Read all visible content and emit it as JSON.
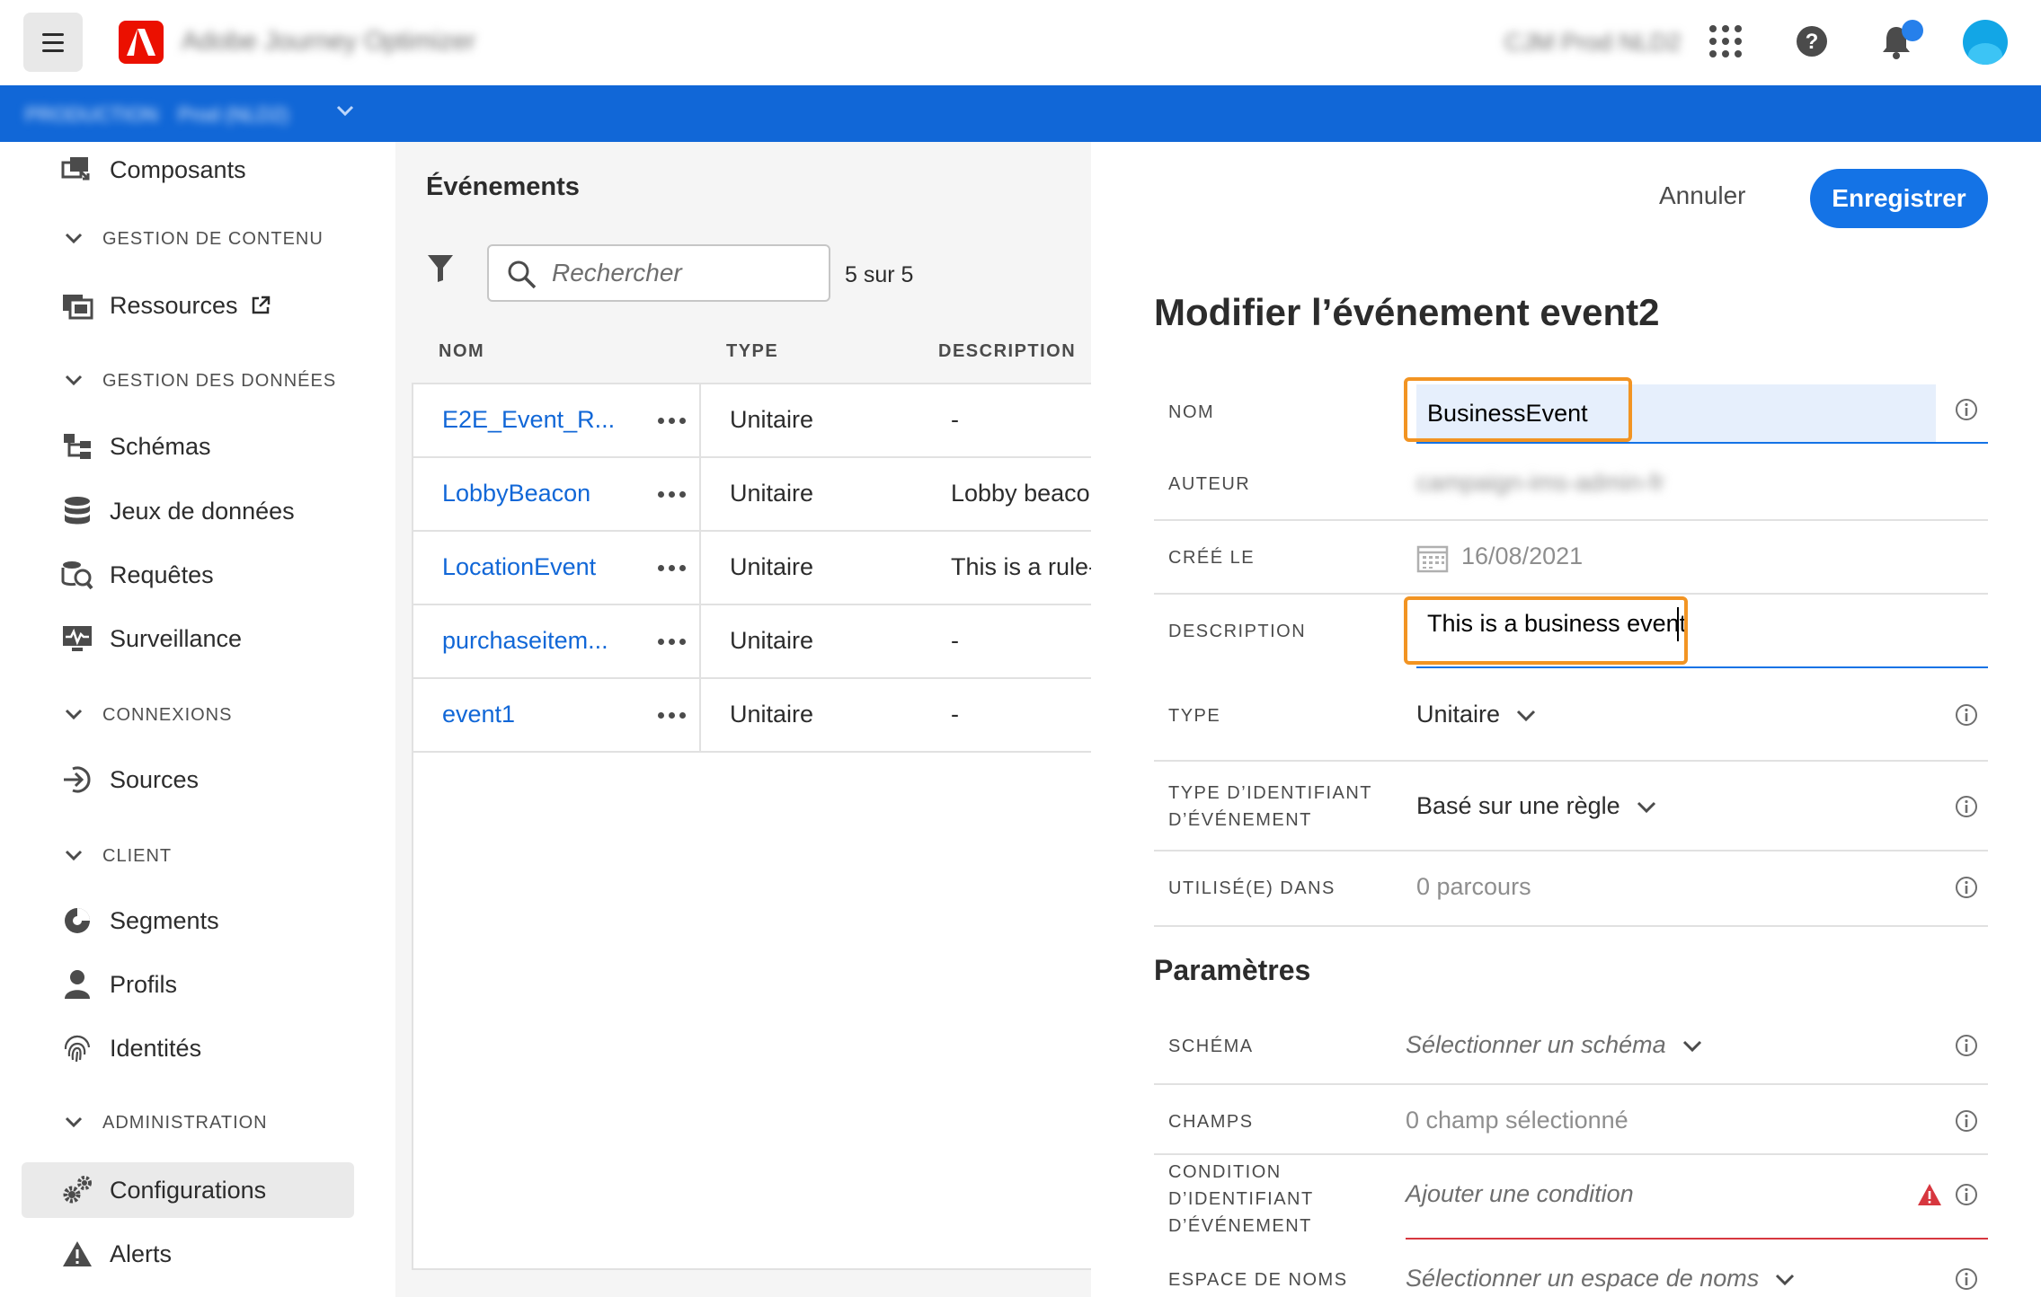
{
  "header": {
    "app_title": "Adobe Journey Optimizer",
    "org_name": "CJM Prod NLD2",
    "icons": [
      "menu-icon",
      "adobe-logo",
      "apps-grid-icon",
      "help-icon",
      "bell-icon",
      "avatar"
    ]
  },
  "sandbox": {
    "label": "PRODUCTION",
    "name": "Prod (NLD2)"
  },
  "sidebar": {
    "items": [
      {
        "label": "Composants",
        "icon": "components-icon"
      },
      {
        "section": "GESTION DE CONTENU"
      },
      {
        "label": "Ressources",
        "icon": "assets-icon",
        "external": true
      },
      {
        "section": "GESTION DES DONNÉES"
      },
      {
        "label": "Schémas",
        "icon": "schema-icon"
      },
      {
        "label": "Jeux de données",
        "icon": "database-icon"
      },
      {
        "label": "Requêtes",
        "icon": "query-icon"
      },
      {
        "label": "Surveillance",
        "icon": "monitoring-icon"
      },
      {
        "section": "CONNEXIONS"
      },
      {
        "label": "Sources",
        "icon": "sources-icon"
      },
      {
        "section": "CLIENT"
      },
      {
        "label": "Segments",
        "icon": "segments-icon"
      },
      {
        "label": "Profils",
        "icon": "profile-icon"
      },
      {
        "label": "Identités",
        "icon": "fingerprint-icon"
      },
      {
        "section": "ADMINISTRATION"
      },
      {
        "label": "Configurations",
        "icon": "gears-icon",
        "active": true
      },
      {
        "label": "Alerts",
        "icon": "alert-icon"
      }
    ]
  },
  "events_list": {
    "title": "Événements",
    "search_placeholder": "Rechercher",
    "count": "5 sur 5",
    "columns": [
      "NOM",
      "TYPE",
      "DESCRIPTION"
    ],
    "rows": [
      {
        "name": "E2E_Event_R...",
        "type": "Unitaire",
        "description": "-"
      },
      {
        "name": "LobbyBeacon",
        "type": "Unitaire",
        "description": "Lobby beacon"
      },
      {
        "name": "LocationEvent",
        "type": "Unitaire",
        "description": "This is a rule-b"
      },
      {
        "name": "purchaseitem...",
        "type": "Unitaire",
        "description": "-"
      },
      {
        "name": "event1",
        "type": "Unitaire",
        "description": "-"
      }
    ]
  },
  "edit": {
    "cancel_label": "Annuler",
    "save_label": "Enregistrer",
    "title": "Modifier l’événement event2",
    "fields": {
      "name_label": "NOM",
      "name_value": "BusinessEvent",
      "author_label": "AUTEUR",
      "author_value": "campaign-ims-admin-fr",
      "created_label": "CRÉÉ LE",
      "created_value": "16/08/2021",
      "description_label": "DESCRIPTION",
      "description_value": "This is a business event",
      "type_label": "TYPE",
      "type_value": "Unitaire",
      "id_type_label_1": "TYPE D’IDENTIFIANT",
      "id_type_label_2": "D’ÉVÉNEMENT",
      "id_type_value": "Basé sur une règle",
      "used_in_label": "UTILISÉ(E) DANS",
      "used_in_value": "0 parcours"
    },
    "params": {
      "title": "Paramètres",
      "schema_label": "SCHÉMA",
      "schema_value": "Sélectionner un schéma",
      "fields_label": "CHAMPS",
      "fields_value": "0 champ sélectionné",
      "condition_label_1": "CONDITION",
      "condition_label_2": "D’IDENTIFIANT",
      "condition_label_3": "D’ÉVÉNEMENT",
      "condition_value": "Ajouter une condition",
      "namespace_label": "ESPACE DE NOMS",
      "namespace_value": "Sélectionner un espace de noms"
    }
  },
  "colors": {
    "brand_blue": "#1167d7",
    "cta_blue": "#1473e6",
    "highlight_orange": "#f29423",
    "error_red": "#d7373f",
    "adobe_red": "#eb1000"
  }
}
